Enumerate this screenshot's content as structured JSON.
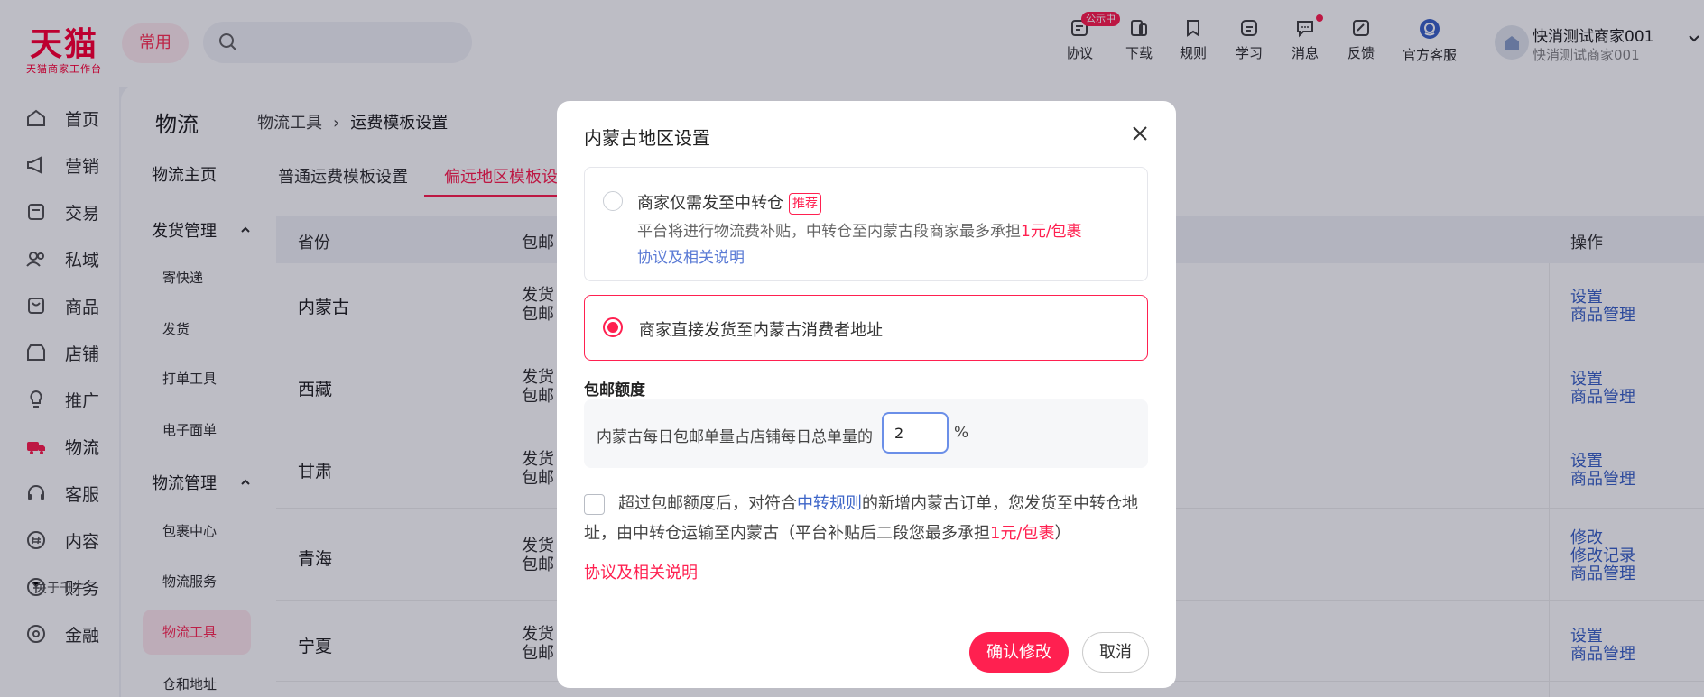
{
  "header": {
    "logo_main": "天猫",
    "logo_sub": "天猫商家工作台",
    "frequent_label": "常用",
    "search_placeholder": "",
    "nav": [
      {
        "label": "协议",
        "icon": "agreement-icon",
        "badge": "公示中"
      },
      {
        "label": "下载",
        "icon": "download-icon"
      },
      {
        "label": "规则",
        "icon": "rules-icon"
      },
      {
        "label": "学习",
        "icon": "learning-icon"
      },
      {
        "label": "消息",
        "icon": "message-icon",
        "dot": true
      },
      {
        "label": "反馈",
        "icon": "feedback-icon"
      },
      {
        "label": "官方客服",
        "icon": "customer-service-icon"
      }
    ],
    "user_name": "快消测试商家001",
    "user_sub": "快消测试商家001"
  },
  "sidebar": {
    "items": [
      {
        "label": "首页",
        "icon": "home-icon"
      },
      {
        "label": "营销",
        "icon": "marketing-icon"
      },
      {
        "label": "交易",
        "icon": "trade-icon"
      },
      {
        "label": "私域",
        "icon": "private-domain-icon"
      },
      {
        "label": "商品",
        "icon": "goods-icon"
      },
      {
        "label": "店铺",
        "icon": "store-icon"
      },
      {
        "label": "推广",
        "icon": "promotion-icon"
      },
      {
        "label": "物流",
        "icon": "logistics-icon",
        "active": true
      },
      {
        "label": "客服",
        "icon": "service-icon"
      },
      {
        "label": "内容",
        "icon": "content-icon"
      },
      {
        "label": "财务",
        "icon": "finance-icon"
      },
      {
        "label": "金融",
        "icon": "financial-icon"
      }
    ],
    "footer": "关于千牛"
  },
  "page": {
    "title": "物流",
    "breadcrumb": [
      "物流工具",
      "运费模板设置"
    ],
    "subnav": {
      "home": "物流主页",
      "groups": [
        {
          "label": "发货管理",
          "items": [
            "寄快递",
            "发货",
            "打单工具",
            "电子面单"
          ]
        },
        {
          "label": "物流管理",
          "items": [
            "包裹中心",
            "物流服务",
            "物流工具",
            "仓和地址"
          ]
        }
      ],
      "active_item": "物流工具"
    },
    "tabs": [
      "普通运费模板设置",
      "偏远地区模板设"
    ],
    "table": {
      "headers": [
        "省份",
        "包邮",
        "操作"
      ],
      "rows": [
        {
          "province": "内蒙古",
          "mail": [
            "发货",
            "包邮"
          ],
          "ops": [
            "设置",
            "商品管理"
          ]
        },
        {
          "province": "西藏",
          "mail": [
            "发货",
            "包邮"
          ],
          "ops": [
            "设置",
            "商品管理"
          ]
        },
        {
          "province": "甘肃",
          "mail": [
            "发货",
            "包邮"
          ],
          "ops": [
            "设置",
            "商品管理"
          ]
        },
        {
          "province": "青海",
          "mail": [
            "发货",
            "包邮"
          ],
          "ops": [
            "修改",
            "修改记录",
            "商品管理"
          ]
        },
        {
          "province": "宁夏",
          "mail": [
            "发货",
            "包邮"
          ],
          "ops": [
            "设置",
            "商品管理"
          ]
        }
      ]
    }
  },
  "modal": {
    "title": "内蒙古地区设置",
    "option1": {
      "label": "商家仅需发至中转仓",
      "tag": "推荐",
      "desc_prefix": "平台将进行物流费补贴，中转仓至内蒙古段商家最多承担",
      "desc_highlight": "1元/包裹",
      "link": "协议及相关说明",
      "selected": false
    },
    "option2": {
      "label": "商家直接发货至内蒙古消费者地址",
      "selected": true
    },
    "quota": {
      "title": "包邮额度",
      "text": "内蒙古每日包邮单量占店铺每日总单量的",
      "value": "2",
      "unit": "%"
    },
    "checkbox": {
      "checked": false,
      "part1": "超过包邮额度后，对符合",
      "link": "中转规则",
      "part2": "的新增内蒙古订单，您发货至中转仓地址，由中转仓运输至内蒙古（平台补贴后二段您最多承担",
      "highlight": "1元/包裹",
      "part3": "）"
    },
    "link": "协议及相关说明",
    "confirm": "确认修改",
    "cancel": "取消"
  },
  "colors": {
    "brand": "#ff0036",
    "accent": "#ff2050",
    "link": "#3d65c8"
  }
}
